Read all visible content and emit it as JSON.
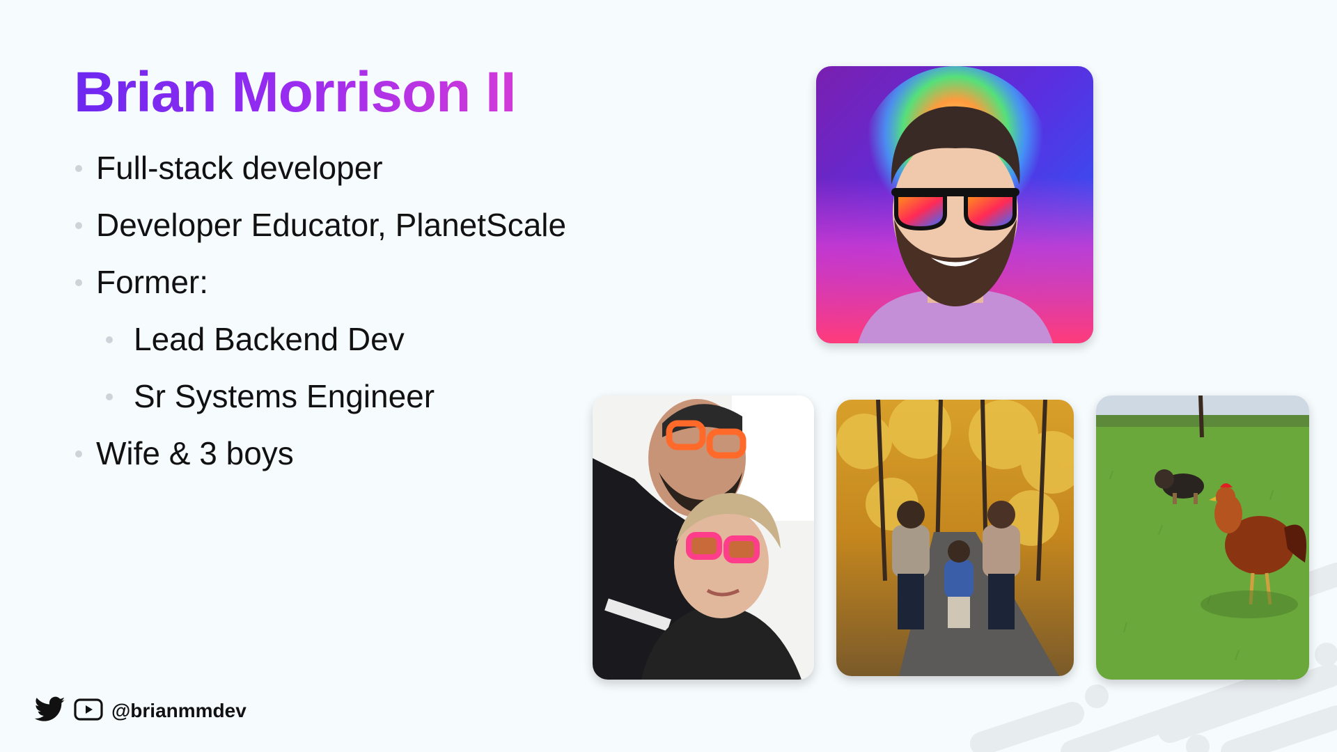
{
  "slide": {
    "title": "Brian Morrison II",
    "bullets": [
      {
        "text": "Full-stack developer",
        "level": 1
      },
      {
        "text": "Developer Educator, PlanetScale",
        "level": 1
      },
      {
        "text": "Former:",
        "level": 1
      },
      {
        "text": "Lead Backend Dev",
        "level": 2
      },
      {
        "text": "Sr Systems Engineer",
        "level": 2
      },
      {
        "text": "Wife & 3 boys",
        "level": 1
      }
    ],
    "footer": {
      "icons": [
        "twitter-icon",
        "youtube-icon"
      ],
      "handle": "@brianmmdev"
    }
  },
  "colors": {
    "background": "#f6fbfd",
    "title_gradient_start": "#6d28f0",
    "title_gradient_end": "#d33ad8",
    "text": "#111111",
    "bullet_dot": "#cdd3d8"
  }
}
